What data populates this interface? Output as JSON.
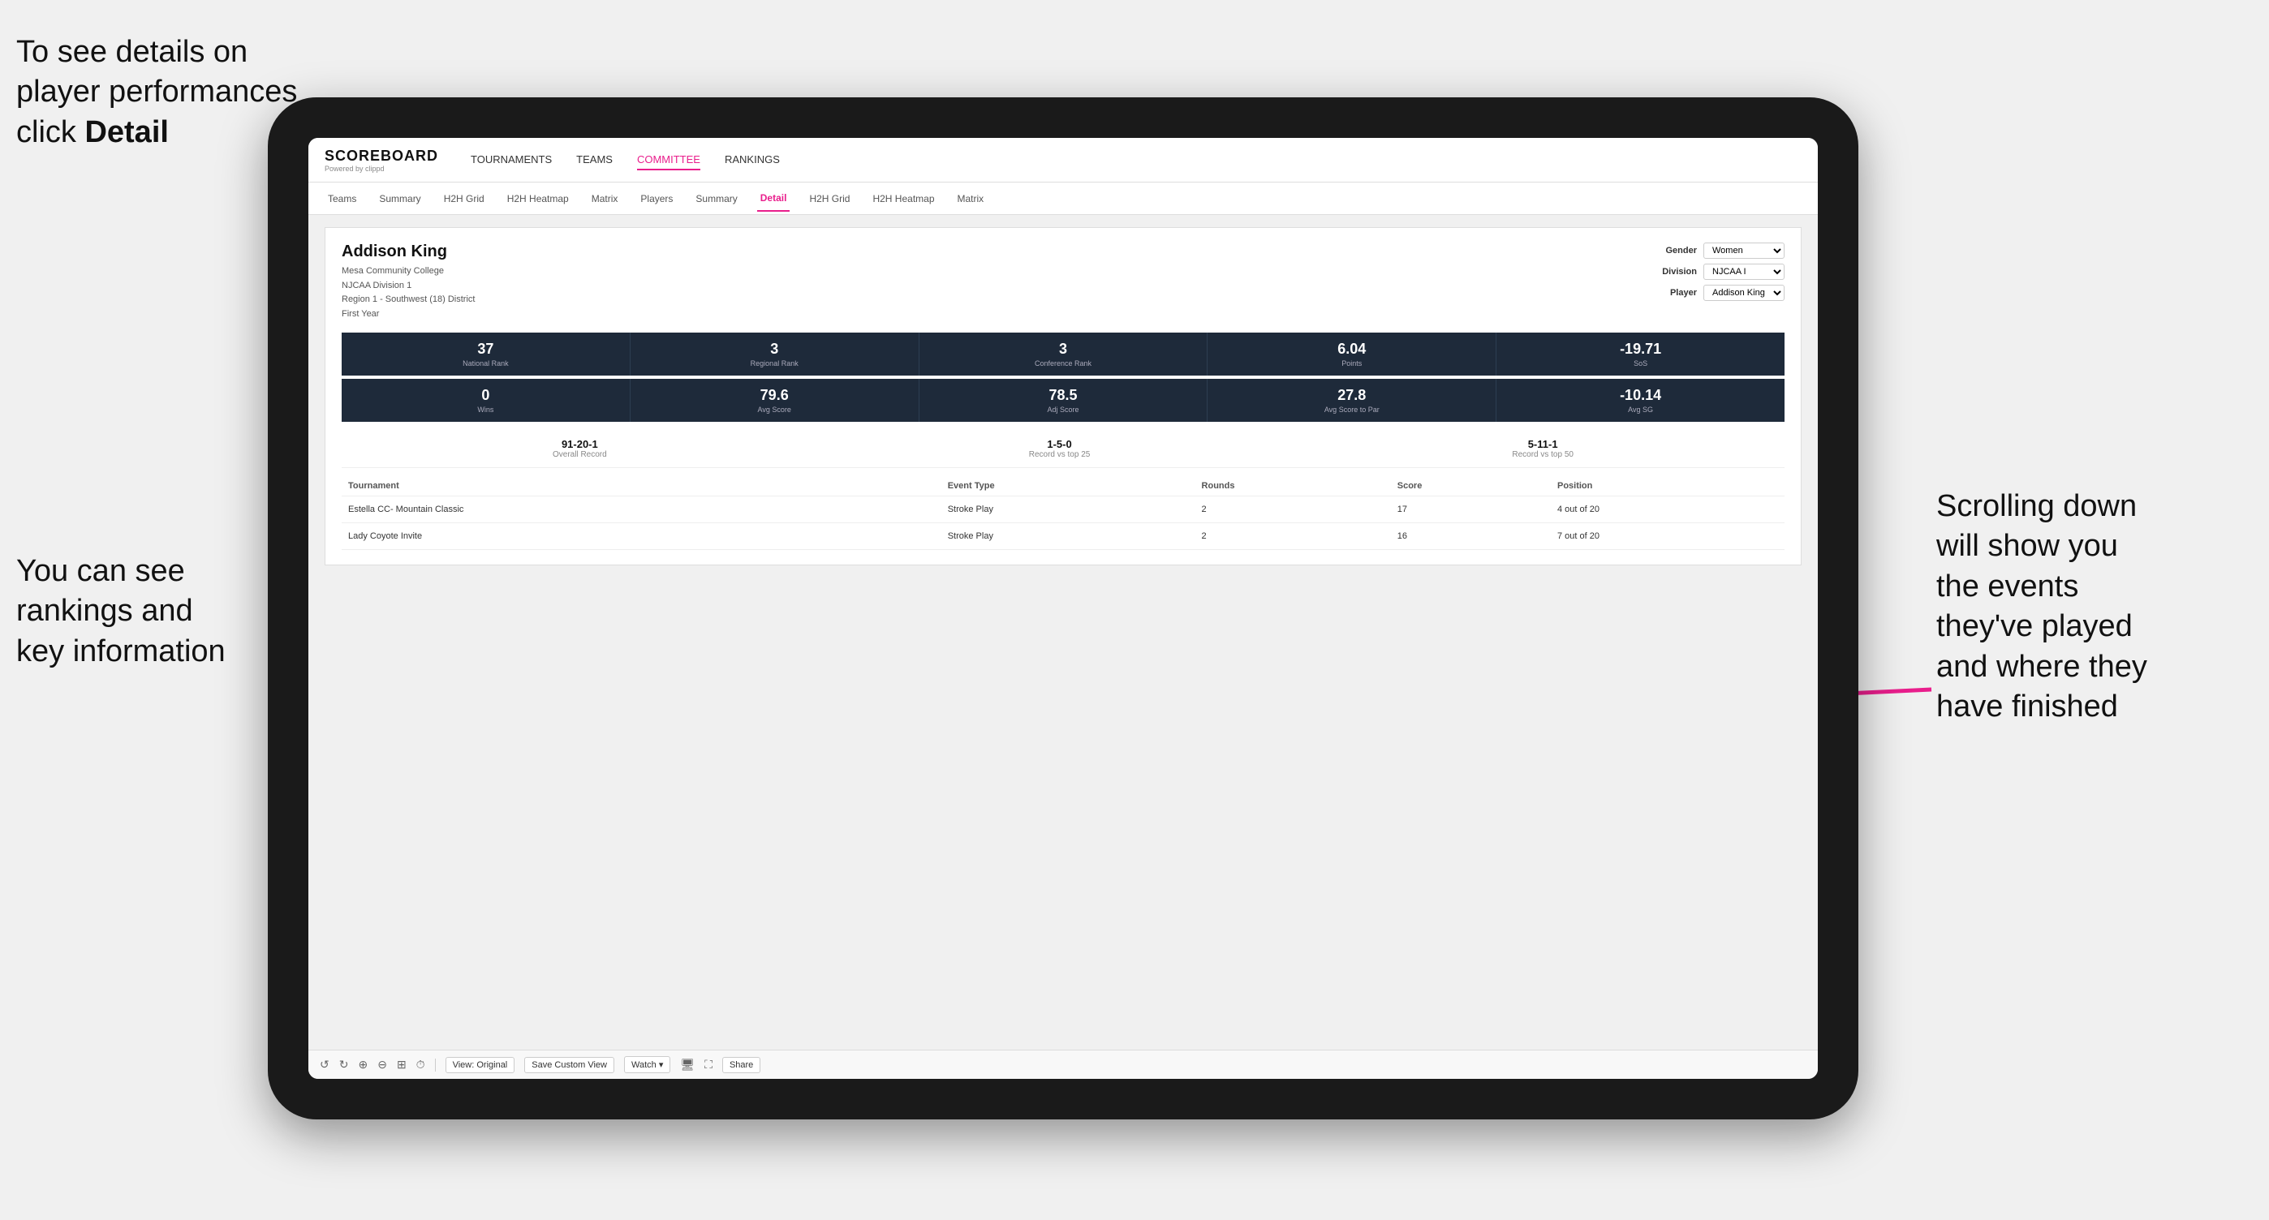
{
  "annotations": {
    "top_left": {
      "line1": "To see details on",
      "line2": "player performances",
      "line3_prefix": "click ",
      "line3_bold": "Detail"
    },
    "bottom_left": {
      "line1": "You can see",
      "line2": "rankings and",
      "line3": "key information"
    },
    "right": {
      "line1": "Scrolling down",
      "line2": "will show you",
      "line3": "the events",
      "line4": "they've played",
      "line5": "and where they",
      "line6": "have finished"
    }
  },
  "nav": {
    "logo": "SCOREBOARD",
    "logo_sub": "Powered by clippd",
    "items": [
      "TOURNAMENTS",
      "TEAMS",
      "COMMITTEE",
      "RANKINGS"
    ],
    "active": "COMMITTEE"
  },
  "subnav": {
    "items": [
      "Teams",
      "Summary",
      "H2H Grid",
      "H2H Heatmap",
      "Matrix",
      "Players",
      "Summary",
      "Detail",
      "H2H Grid",
      "H2H Heatmap",
      "Matrix"
    ],
    "active": "Detail"
  },
  "player": {
    "name": "Addison King",
    "college": "Mesa Community College",
    "division": "NJCAA Division 1",
    "region": "Region 1 - Southwest (18) District",
    "year": "First Year"
  },
  "filters": {
    "gender_label": "Gender",
    "gender_value": "Women",
    "division_label": "Division",
    "division_value": "NJCAA I",
    "player_label": "Player",
    "player_value": "Addison King"
  },
  "stats_row1": [
    {
      "value": "37",
      "label": "National Rank"
    },
    {
      "value": "3",
      "label": "Regional Rank"
    },
    {
      "value": "3",
      "label": "Conference Rank"
    },
    {
      "value": "6.04",
      "label": "Points"
    },
    {
      "value": "-19.71",
      "label": "SoS"
    }
  ],
  "stats_row2": [
    {
      "value": "0",
      "label": "Wins"
    },
    {
      "value": "79.6",
      "label": "Avg Score"
    },
    {
      "value": "78.5",
      "label": "Adj Score"
    },
    {
      "value": "27.8",
      "label": "Avg Score to Par"
    },
    {
      "value": "-10.14",
      "label": "Avg SG"
    }
  ],
  "records": [
    {
      "value": "91-20-1",
      "label": "Overall Record"
    },
    {
      "value": "1-5-0",
      "label": "Record vs top 25"
    },
    {
      "value": "5-11-1",
      "label": "Record vs top 50"
    }
  ],
  "table": {
    "headers": [
      "Tournament",
      "",
      "Event Type",
      "Rounds",
      "Score",
      "Position"
    ],
    "rows": [
      {
        "tournament": "Estella CC- Mountain Classic",
        "event_type": "Stroke Play",
        "rounds": "2",
        "score": "17",
        "position": "4 out of 20"
      },
      {
        "tournament": "Lady Coyote Invite",
        "event_type": "Stroke Play",
        "rounds": "2",
        "score": "16",
        "position": "7 out of 20"
      }
    ]
  },
  "toolbar": {
    "buttons": [
      "View: Original",
      "Save Custom View",
      "Watch ▾",
      "Share"
    ]
  }
}
